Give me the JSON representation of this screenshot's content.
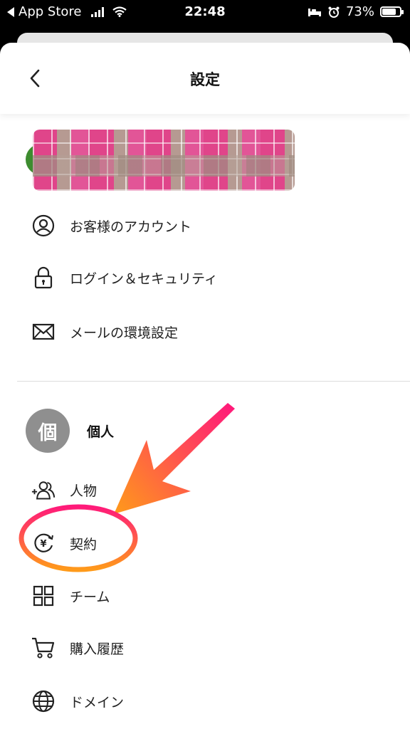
{
  "status_bar": {
    "back_app": "App Store",
    "time": "22:48",
    "battery": "73%",
    "battery_level": 0.73
  },
  "header": {
    "title": "設定"
  },
  "account_menu": [
    {
      "label": "お客様のアカウント",
      "icon": "user-circle-icon"
    },
    {
      "label": "ログイン＆セキュリティ",
      "icon": "lock-icon"
    },
    {
      "label": "メールの環境設定",
      "icon": "envelope-icon"
    }
  ],
  "section": {
    "avatar_char": "個",
    "title": "個人"
  },
  "section_menu": [
    {
      "label": "人物",
      "icon": "add-person-icon"
    },
    {
      "label": "契約",
      "icon": "yen-renew-icon"
    },
    {
      "label": "チーム",
      "icon": "grid-icon"
    },
    {
      "label": "購入履歴",
      "icon": "cart-icon"
    },
    {
      "label": "ドメイン",
      "icon": "globe-icon"
    }
  ],
  "annotation": {
    "arrow_color_start": "#ff1a7a",
    "arrow_color_end": "#ff9a1a",
    "highlight_target": "契約"
  }
}
